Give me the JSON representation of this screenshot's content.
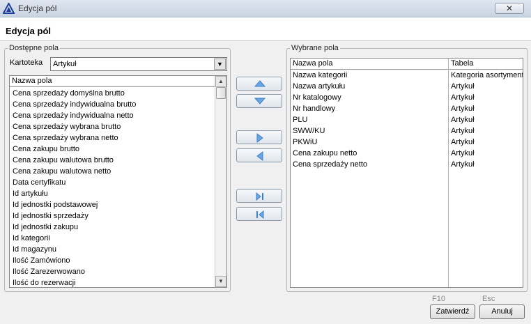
{
  "window": {
    "title": "Edycja pól",
    "close_glyph": "✕"
  },
  "header": {
    "title": "Edycja pól"
  },
  "available": {
    "group_label": "Dostępne pola",
    "kartoteka_label": "Kartoteka",
    "kartoteka_value": "Artykuł",
    "column_header": "Nazwa pola",
    "items": [
      "Cena sprzedaży domyślna brutto",
      "Cena sprzedaży indywidualna brutto",
      "Cena sprzedaży indywidualna netto",
      "Cena sprzedaży wybrana brutto",
      "Cena sprzedaży wybrana netto",
      "Cena zakupu brutto",
      "Cena zakupu walutowa brutto",
      "Cena zakupu walutowa netto",
      "Data certyfikatu",
      "Id artykułu",
      "Id jednostki podstawowej",
      "Id jednostki sprzedaży",
      "Id jednostki zakupu",
      "Id kategorii",
      "Id magazynu",
      "Ilość Zamówiono",
      "Ilość Zarezerwowano",
      "Ilość do rezerwacji"
    ],
    "scroll_position": 0.0
  },
  "selected": {
    "group_label": "Wybrane pola",
    "headers": {
      "name": "Nazwa pola",
      "table": "Tabela"
    },
    "rows": [
      {
        "name": "Nazwa kategorii",
        "table": "Kategoria asortymentowa"
      },
      {
        "name": "Nazwa artykułu",
        "table": "Artykuł"
      },
      {
        "name": "Nr katalogowy",
        "table": "Artykuł"
      },
      {
        "name": "Nr handlowy",
        "table": "Artykuł"
      },
      {
        "name": "PLU",
        "table": "Artykuł"
      },
      {
        "name": "SWW/KU",
        "table": "Artykuł"
      },
      {
        "name": "PKWiU",
        "table": "Artykuł"
      },
      {
        "name": "Cena zakupu netto",
        "table": "Artykuł"
      },
      {
        "name": "Cena sprzedaży netto",
        "table": "Artykuł"
      }
    ]
  },
  "move_buttons": [
    "arrow-up-icon",
    "arrow-down-icon",
    "arrow-right-icon",
    "arrow-left-icon",
    "move-all-right-icon",
    "move-all-left-icon"
  ],
  "footer": {
    "confirm_key": "F10",
    "confirm_label": "Zatwierdź",
    "cancel_key": "Esc",
    "cancel_label": "Anuluj"
  },
  "colors": {
    "arrow": "#3d7fc7",
    "arrow_light": "#7fb2e5"
  }
}
